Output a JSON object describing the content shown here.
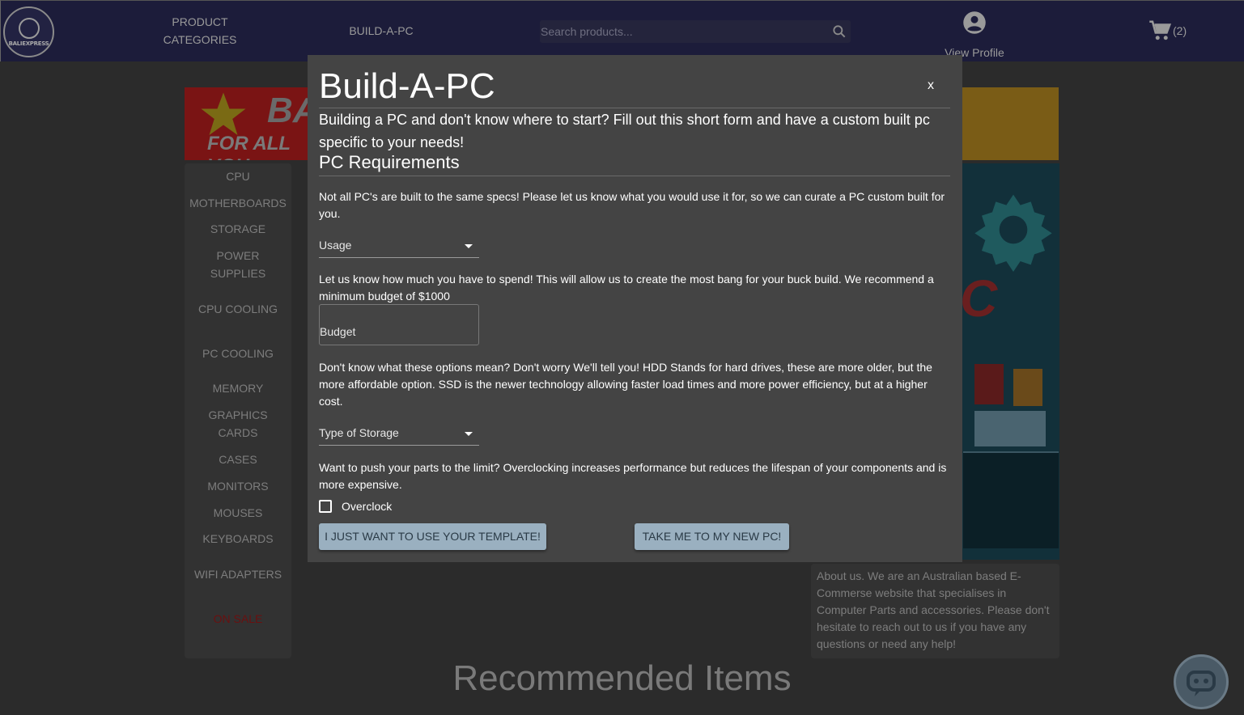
{
  "navbar": {
    "logo_text": "BALIEXPRESS",
    "product_categories": "PRODUCT CATEGORIES",
    "build_a_pc": "BUILD-A-PC",
    "search_placeholder": "Search products...",
    "view_profile": "View Profile",
    "cart_count": "(2)"
  },
  "banner": {
    "text_top": "BA",
    "text_bottom": "FOR ALL YOU"
  },
  "side_ad": {
    "text": "C"
  },
  "sidebar": {
    "items": [
      {
        "label": "CPU"
      },
      {
        "label": "MOTHERBOARDS"
      },
      {
        "label": "STORAGE"
      },
      {
        "label": "POWER SUPPLIES"
      },
      {
        "label": "CPU COOLING"
      },
      {
        "label": "PC COOLING"
      },
      {
        "label": "MEMORY"
      },
      {
        "label": "GRAPHICS CARDS"
      },
      {
        "label": "CASES"
      },
      {
        "label": "MONITORS"
      },
      {
        "label": "MOUSES"
      },
      {
        "label": "KEYBOARDS"
      },
      {
        "label": "WIFI ADAPTERS"
      },
      {
        "label": "ON SALE"
      }
    ]
  },
  "about": {
    "text": "About us. We are an Australian based E-Commerse website that specialises in Computer Parts and accessories. Please don't hesitate to reach out to us if you have any questions or need any help!"
  },
  "recommended_title": "Recommended Items",
  "modal": {
    "title": "Build-A-PC",
    "close": "x",
    "intro": "Building a PC and don't know where to start? Fill out this short form and have a custom built pc specific to your needs!",
    "section_title": "PC Requirements",
    "usage_text": "Not all PC's are built to the same specs! Please let us know what you would use it for, so we can curate a PC custom built for you.",
    "usage_select": "Usage",
    "budget_text": "Let us know how much you have to spend! This will allow us to create the most bang for your buck build. We recommend a minimum budget of $1000",
    "budget_placeholder": "Budget",
    "storage_text": "Don't know what these options mean? Don't worry We'll tell you! HDD Stands for hard drives, these are more older, but the more affordable option. SSD is the newer technology allowing faster load times and more power efficiency, but at a higher cost.",
    "storage_select": "Type of Storage",
    "overclock_text": "Want to push your parts to the limit? Overclocking increases performance but reduces the lifespan of your components and is more expensive.",
    "overclock_label": "Overclock",
    "template_button": "I JUST WANT TO USE YOUR TEMPLATE!",
    "new_pc_button": "TAKE ME TO MY NEW PC!"
  }
}
